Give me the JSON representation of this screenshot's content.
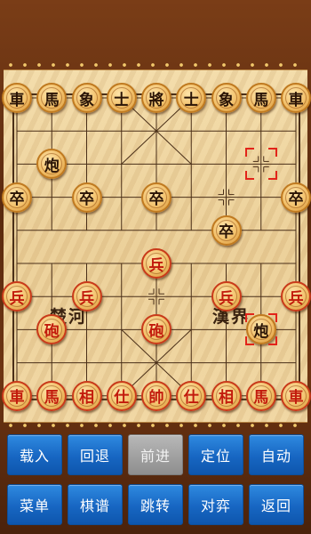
{
  "board": {
    "river_left": "楚河",
    "river_right": "漢界",
    "pieces": [
      {
        "side": "black",
        "label": "車",
        "name": "black-chariot-left-piece",
        "col": 0,
        "row": 0
      },
      {
        "side": "black",
        "label": "馬",
        "name": "black-horse-left-piece",
        "col": 1,
        "row": 0
      },
      {
        "side": "black",
        "label": "象",
        "name": "black-elephant-left-piece",
        "col": 2,
        "row": 0
      },
      {
        "side": "black",
        "label": "士",
        "name": "black-advisor-left-piece",
        "col": 3,
        "row": 0
      },
      {
        "side": "black",
        "label": "將",
        "name": "black-general-piece",
        "col": 4,
        "row": 0
      },
      {
        "side": "black",
        "label": "士",
        "name": "black-advisor-right-piece",
        "col": 5,
        "row": 0
      },
      {
        "side": "black",
        "label": "象",
        "name": "black-elephant-right-piece",
        "col": 6,
        "row": 0
      },
      {
        "side": "black",
        "label": "馬",
        "name": "black-horse-right-piece",
        "col": 7,
        "row": 0
      },
      {
        "side": "black",
        "label": "車",
        "name": "black-chariot-right-piece",
        "col": 8,
        "row": 0
      },
      {
        "side": "black",
        "label": "炮",
        "name": "black-cannon-piece",
        "col": 1,
        "row": 2
      },
      {
        "side": "black",
        "label": "卒",
        "name": "black-soldier-1-piece",
        "col": 0,
        "row": 3
      },
      {
        "side": "black",
        "label": "卒",
        "name": "black-soldier-2-piece",
        "col": 2,
        "row": 3
      },
      {
        "side": "black",
        "label": "卒",
        "name": "black-soldier-3-piece",
        "col": 4,
        "row": 3
      },
      {
        "side": "black",
        "label": "卒",
        "name": "black-soldier-4-piece",
        "col": 6,
        "row": 4
      },
      {
        "side": "black",
        "label": "卒",
        "name": "black-soldier-5-piece",
        "col": 8,
        "row": 3
      },
      {
        "side": "black",
        "label": "炮",
        "name": "black-cannon-moved-piece",
        "col": 7,
        "row": 7
      },
      {
        "side": "red",
        "label": "兵",
        "name": "red-soldier-center-piece",
        "col": 4,
        "row": 5
      },
      {
        "side": "red",
        "label": "兵",
        "name": "red-soldier-1-piece",
        "col": 0,
        "row": 6
      },
      {
        "side": "red",
        "label": "兵",
        "name": "red-soldier-2-piece",
        "col": 2,
        "row": 6
      },
      {
        "side": "red",
        "label": "兵",
        "name": "red-soldier-4-piece",
        "col": 6,
        "row": 6
      },
      {
        "side": "red",
        "label": "兵",
        "name": "red-soldier-5-piece",
        "col": 8,
        "row": 6
      },
      {
        "side": "red",
        "label": "砲",
        "name": "red-cannon-left-piece",
        "col": 1,
        "row": 7
      },
      {
        "side": "red",
        "label": "砲",
        "name": "red-cannon-right-piece",
        "col": 4,
        "row": 7
      },
      {
        "side": "red",
        "label": "車",
        "name": "red-chariot-left-piece",
        "col": 0,
        "row": 9
      },
      {
        "side": "red",
        "label": "馬",
        "name": "red-horse-left-piece",
        "col": 1,
        "row": 9
      },
      {
        "side": "red",
        "label": "相",
        "name": "red-elephant-left-piece",
        "col": 2,
        "row": 9
      },
      {
        "side": "red",
        "label": "仕",
        "name": "red-advisor-left-piece",
        "col": 3,
        "row": 9
      },
      {
        "side": "red",
        "label": "帥",
        "name": "red-general-piece",
        "col": 4,
        "row": 9
      },
      {
        "side": "red",
        "label": "仕",
        "name": "red-advisor-right-piece",
        "col": 5,
        "row": 9
      },
      {
        "side": "red",
        "label": "相",
        "name": "red-elephant-right-piece",
        "col": 6,
        "row": 9
      },
      {
        "side": "red",
        "label": "馬",
        "name": "red-horse-right-piece",
        "col": 7,
        "row": 9
      },
      {
        "side": "red",
        "label": "車",
        "name": "red-chariot-right-piece",
        "col": 8,
        "row": 9
      }
    ],
    "last_move": {
      "from": {
        "col": 7,
        "row": 2
      },
      "to": {
        "col": 7,
        "row": 7
      }
    }
  },
  "buttons": [
    {
      "label": "载入",
      "name": "load-button",
      "enabled": true
    },
    {
      "label": "回退",
      "name": "undo-button",
      "enabled": true
    },
    {
      "label": "前进",
      "name": "redo-button",
      "enabled": false
    },
    {
      "label": "定位",
      "name": "locate-button",
      "enabled": true
    },
    {
      "label": "自动",
      "name": "auto-button",
      "enabled": true
    },
    {
      "label": "菜单",
      "name": "menu-button",
      "enabled": true
    },
    {
      "label": "棋谱",
      "name": "game-record-button",
      "enabled": true
    },
    {
      "label": "跳转",
      "name": "jump-button",
      "enabled": true
    },
    {
      "label": "对弈",
      "name": "play-button",
      "enabled": true
    },
    {
      "label": "返回",
      "name": "back-button",
      "enabled": true
    }
  ]
}
